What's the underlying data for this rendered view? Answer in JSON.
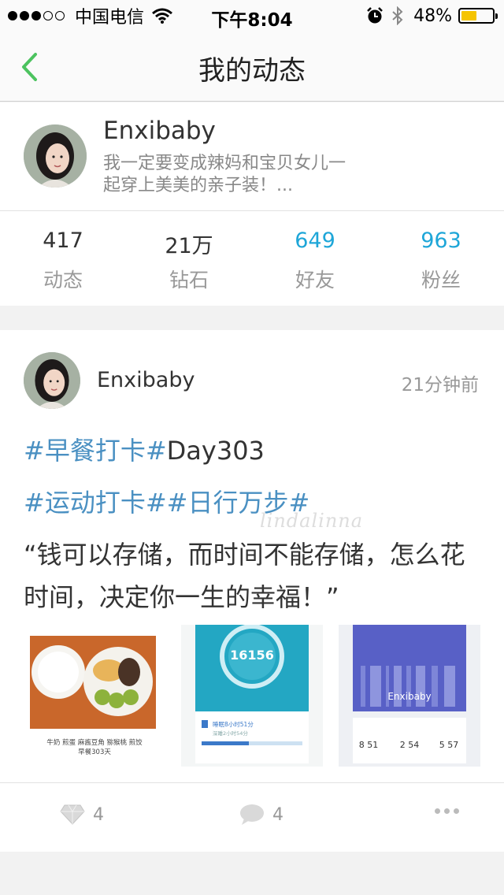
{
  "status": {
    "carrier": "中国电信",
    "time": "下午8:04",
    "battery": "48%",
    "battery_level": 0.48
  },
  "nav": {
    "title": "我的动态"
  },
  "profile": {
    "name": "Enxibaby",
    "bio": "我一定要变成辣妈和宝贝女儿一起穿上美美的亲子装！...",
    "stats": [
      {
        "value": "417",
        "label": "动态"
      },
      {
        "value": "21万",
        "label": "钻石"
      },
      {
        "value": "649",
        "label": "好友"
      },
      {
        "value": "963",
        "label": "粉丝"
      }
    ]
  },
  "post": {
    "user": "Enxibaby",
    "time": "21分钟前",
    "tag_line1_hashtag": "#早餐打卡#",
    "tag_line1_text": "Day303",
    "tag_line2": "#运动打卡##日行万步#",
    "quote": "“钱可以存储，而时间不能存储，怎么花时间，决定你一生的幸福！”",
    "watermark": "lindalinna",
    "images": [
      {
        "caption_line1": "牛奶 煎蛋 麻酱豆角 猕猴桃 煎饺",
        "caption_line2": "早餐303天"
      },
      {
        "steps": "16156",
        "sleep_text": "睡眠8小时51分",
        "sleep_sub": "深睡2小时54分"
      },
      {
        "brand": "Enxibaby",
        "stats": [
          "8 51",
          "2 54",
          "5 57"
        ]
      }
    ],
    "actions": {
      "diamond_count": "4",
      "comment_count": "4"
    }
  },
  "colors": {
    "accent_blue": "#1ea6d8",
    "hashtag": "#4a90c2",
    "back_green": "#4cc35f"
  },
  "icons": [
    "wifi-icon",
    "alarm-icon",
    "bluetooth-icon",
    "battery-icon",
    "back-chevron-icon",
    "diamond-icon",
    "comment-icon",
    "more-icon"
  ]
}
